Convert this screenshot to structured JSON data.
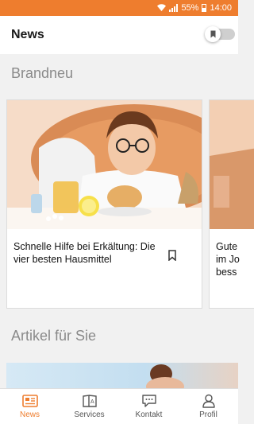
{
  "status_bar": {
    "battery": "55%",
    "time": "14:00",
    "background": "#ee7d2e"
  },
  "app_bar": {
    "title": "News"
  },
  "sections": {
    "new_title": "Brandneu",
    "for_you_title": "Artikel für Sie"
  },
  "articles": [
    {
      "title": "Schnelle Hilfe bei Erkältung: Die vier besten Hausmittel"
    },
    {
      "title": "Gute\nim Jo\nbess"
    }
  ],
  "bottom_nav": {
    "items": [
      {
        "label": "News",
        "icon": "news-icon"
      },
      {
        "label": "Services",
        "icon": "services-icon"
      },
      {
        "label": "Kontakt",
        "icon": "chat-icon"
      },
      {
        "label": "Profil",
        "icon": "profile-icon"
      }
    ]
  },
  "colors": {
    "accent": "#ee7d2e"
  }
}
